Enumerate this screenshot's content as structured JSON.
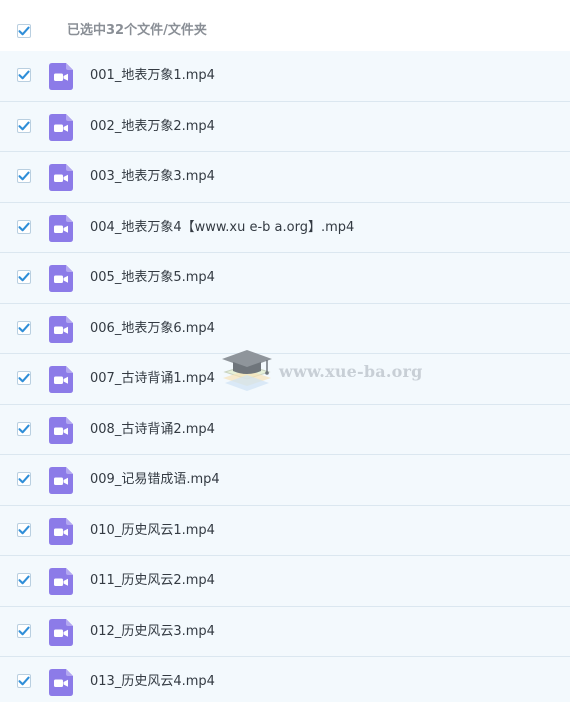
{
  "header": {
    "selection_label": "已选中32个文件/文件夹",
    "select_all_checked": true
  },
  "colors": {
    "check_accent": "#2f8ed8",
    "row_background": "#f3f9fd",
    "row_divider": "#dbe7f0",
    "file_icon": "#8c7be8"
  },
  "icons": {
    "checkbox": "checkmark-icon",
    "file": "video-file-icon",
    "watermark": "graduation-cap-icon"
  },
  "files": [
    {
      "name": "001_地表万象1.mp4",
      "checked": true
    },
    {
      "name": "002_地表万象2.mp4",
      "checked": true
    },
    {
      "name": "003_地表万象3.mp4",
      "checked": true
    },
    {
      "name": "004_地表万象4【www.xu e-b a.org】.mp4",
      "checked": true
    },
    {
      "name": "005_地表万象5.mp4",
      "checked": true
    },
    {
      "name": "006_地表万象6.mp4",
      "checked": true
    },
    {
      "name": "007_古诗背诵1.mp4",
      "checked": true
    },
    {
      "name": "008_古诗背诵2.mp4",
      "checked": true
    },
    {
      "name": "009_记易错成语.mp4",
      "checked": true
    },
    {
      "name": "010_历史风云1.mp4",
      "checked": true
    },
    {
      "name": "011_历史风云2.mp4",
      "checked": true
    },
    {
      "name": "012_历史风云3.mp4",
      "checked": true
    },
    {
      "name": "013_历史风云4.mp4",
      "checked": true
    }
  ],
  "watermark": {
    "text": "www.xue-ba.org"
  }
}
